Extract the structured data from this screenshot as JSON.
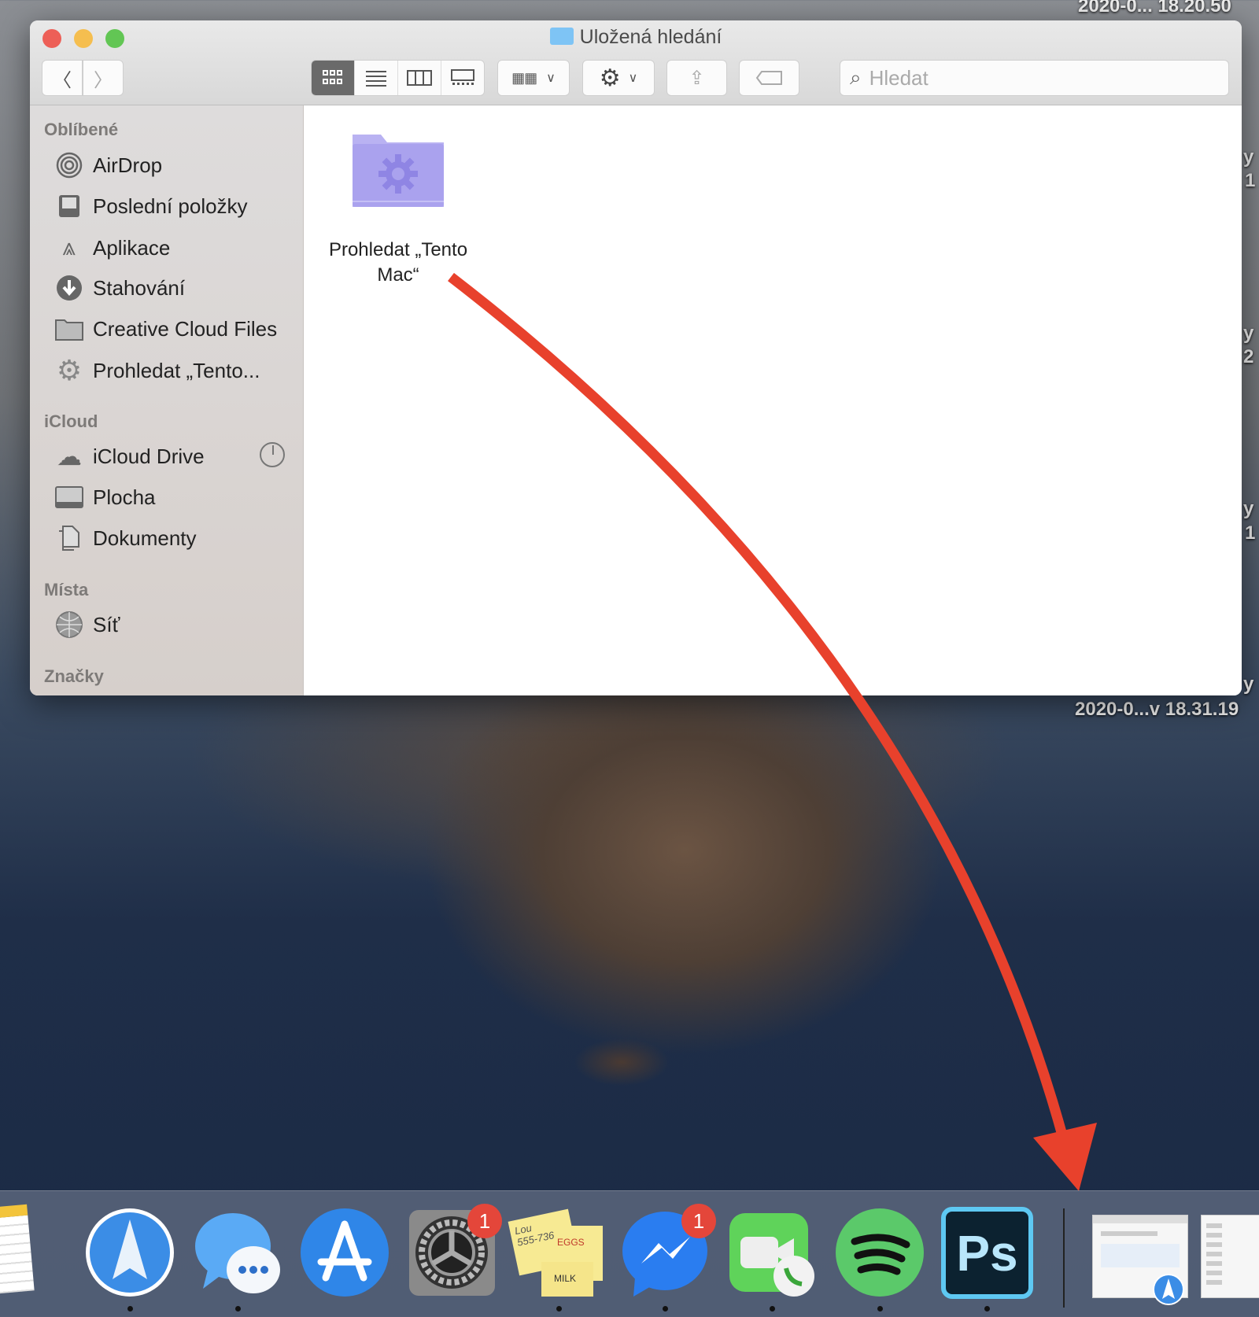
{
  "desktop": {
    "top_file_label": "2020-0... 18.20.50",
    "bottom_file_label": "2020-0...v 18.31.19",
    "partial_labels": [
      "y",
      "1",
      "y",
      "2",
      "y",
      "1",
      "y"
    ]
  },
  "window": {
    "title": "Uložená hledání",
    "toolbar": {
      "back": "back-icon",
      "forward": "forward-icon",
      "search_placeholder": "Hledat"
    },
    "sidebar": {
      "sections": [
        {
          "header": "Oblíbené",
          "items": [
            {
              "label": "AirDrop",
              "icon": "airdrop-icon"
            },
            {
              "label": "Poslední položky",
              "icon": "recents-icon"
            },
            {
              "label": "Aplikace",
              "icon": "applications-icon"
            },
            {
              "label": "Stahování",
              "icon": "downloads-icon"
            },
            {
              "label": "Creative Cloud Files",
              "icon": "folder-icon"
            },
            {
              "label": "Prohledat „Tento...",
              "icon": "gear-icon"
            }
          ]
        },
        {
          "header": "iCloud",
          "items": [
            {
              "label": "iCloud Drive",
              "icon": "cloud-icon"
            },
            {
              "label": "Plocha",
              "icon": "desktop-icon"
            },
            {
              "label": "Dokumenty",
              "icon": "documents-icon"
            }
          ]
        },
        {
          "header": "Místa",
          "items": [
            {
              "label": "Síť",
              "icon": "network-icon"
            }
          ]
        },
        {
          "header": "Značky",
          "items": []
        }
      ]
    },
    "content": {
      "items": [
        {
          "label_line1": "Prohledat „Tento",
          "label_line2": "Mac“",
          "icon": "smart-folder-icon"
        }
      ]
    }
  },
  "dock": {
    "apps": [
      {
        "name": "Notes"
      },
      {
        "name": "Spark",
        "running": true
      },
      {
        "name": "Messages",
        "running": true
      },
      {
        "name": "App Store"
      },
      {
        "name": "System Preferences",
        "badge": "1"
      },
      {
        "name": "Stickies",
        "running": true,
        "note_text": [
          "Lou",
          "555-7361",
          "EGGS",
          "MILK"
        ]
      },
      {
        "name": "Messenger",
        "badge": "1",
        "running": true
      },
      {
        "name": "FaceTime",
        "running": true
      },
      {
        "name": "Spotify",
        "running": true
      },
      {
        "name": "Photoshop",
        "running": true,
        "text": "Ps"
      }
    ]
  },
  "colors": {
    "annotation_arrow": "#e8412c",
    "close": "#ed5f57",
    "minimize": "#f5be4f",
    "zoom": "#62c654"
  }
}
